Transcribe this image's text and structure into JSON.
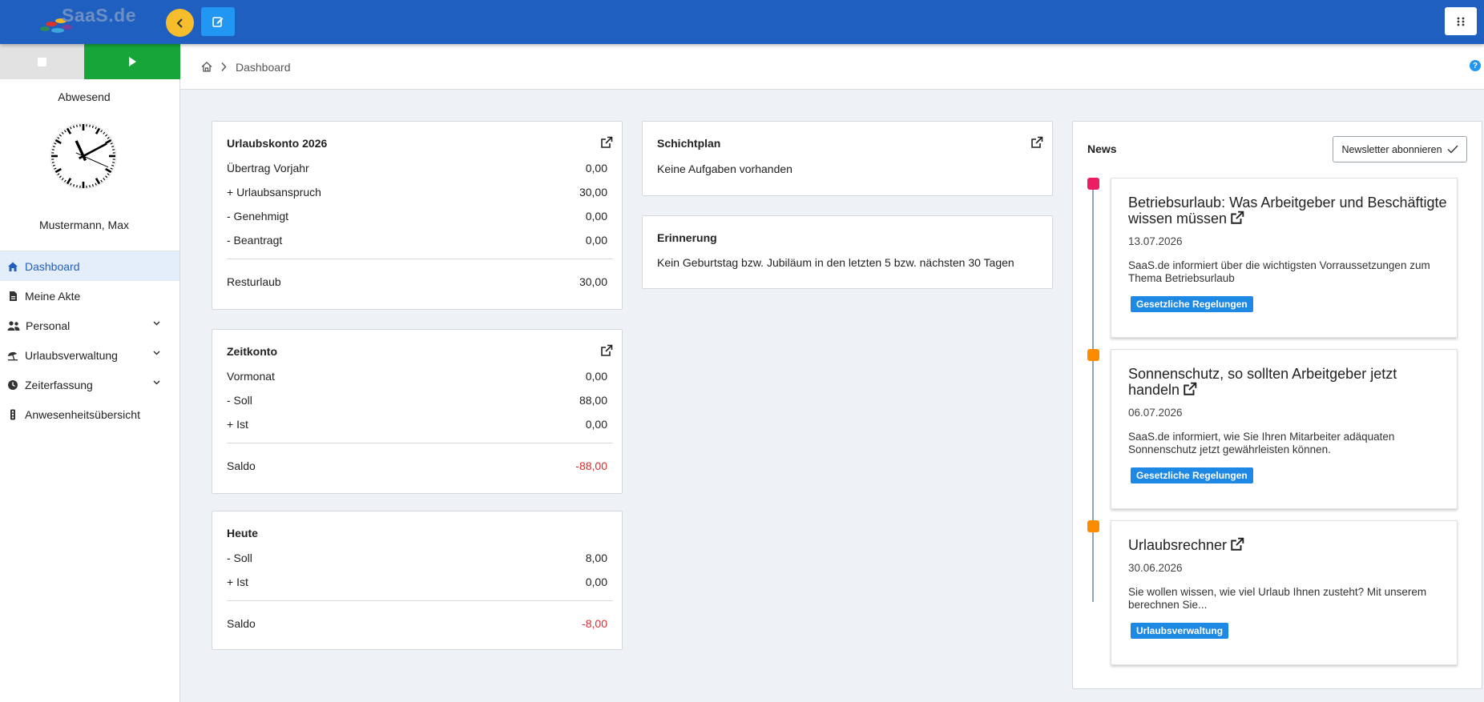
{
  "header": {
    "logo_text": "SaaS.de",
    "colors": {
      "bar": "#1f5fbf",
      "back_button": "#f6be2c",
      "edit_button": "#2196f3"
    }
  },
  "sidebar": {
    "status": "Abwesend",
    "user": "Mustermann, Max",
    "clock_time": "11:10:19",
    "nav": [
      {
        "label": "Dashboard",
        "icon": "home-icon",
        "active": true
      },
      {
        "label": "Meine Akte",
        "icon": "file-icon"
      },
      {
        "label": "Personal",
        "icon": "users-icon",
        "expandable": true
      },
      {
        "label": "Urlaubsverwaltung",
        "icon": "umbrella-icon",
        "expandable": true
      },
      {
        "label": "Zeiterfassung",
        "icon": "clock-icon",
        "expandable": true
      },
      {
        "label": "Anwesenheitsübersicht",
        "icon": "traffic-light-icon"
      }
    ]
  },
  "breadcrumb": {
    "current": "Dashboard"
  },
  "urlaubskonto": {
    "title": "Urlaubskonto 2026",
    "rows": [
      {
        "label": "Übertrag Vorjahr",
        "value": "0,00"
      },
      {
        "label": "+ Urlaubsanspruch",
        "value": "30,00"
      },
      {
        "label": "- Genehmigt",
        "value": "0,00"
      },
      {
        "label": "- Beantragt",
        "value": "0,00"
      }
    ],
    "total": {
      "label": "Resturlaub",
      "value": "30,00"
    }
  },
  "zeitkonto": {
    "title": "Zeitkonto",
    "rows": [
      {
        "label": "Vormonat",
        "value": "0,00"
      },
      {
        "label": "- Soll",
        "value": "88,00"
      },
      {
        "label": "+ Ist",
        "value": "0,00"
      }
    ],
    "total": {
      "label": "Saldo",
      "value": "-88,00"
    }
  },
  "heute": {
    "title": "Heute",
    "rows": [
      {
        "label": "- Soll",
        "value": "8,00"
      },
      {
        "label": "+ Ist",
        "value": "0,00"
      }
    ],
    "total": {
      "label": "Saldo",
      "value": "-8,00"
    }
  },
  "schichtplan": {
    "title": "Schichtplan",
    "text": "Keine Aufgaben vorhanden"
  },
  "erinnerung": {
    "title": "Erinnerung",
    "text": "Kein Geburtstag bzw. Jubiläum in den letzten 5 bzw. nächsten 30 Tagen"
  },
  "news": {
    "title": "News",
    "newsletter_button": "Newsletter abonnieren",
    "items": [
      {
        "title": "Betriebsurlaub: Was Arbeitgeber und Beschäftigte wissen müssen",
        "date": "13.07.2026",
        "description": "SaaS.de informiert über die wichtigsten Vorraussetzungen zum Thema Betriebsurlaub",
        "tag": "Gesetzliche Regelungen",
        "marker_color": "#e91e63"
      },
      {
        "title": "Sonnenschutz, so sollten Arbeitgeber jetzt handeln",
        "date": "06.07.2026",
        "description": "SaaS.de informiert, wie Sie Ihren Mitarbeiter adäquaten Sonnenschutz jetzt gewährleisten können.",
        "tag": "Gesetzliche Regelungen",
        "marker_color": "#fb8c00"
      },
      {
        "title": "Urlaubsrechner",
        "date": "30.06.2026",
        "description": "Sie wollen wissen, wie viel Urlaub Ihnen zusteht? Mit unserem berechnen Sie...",
        "tag": "Urlaubsverwaltung",
        "marker_color": "#fb8c00"
      }
    ]
  }
}
